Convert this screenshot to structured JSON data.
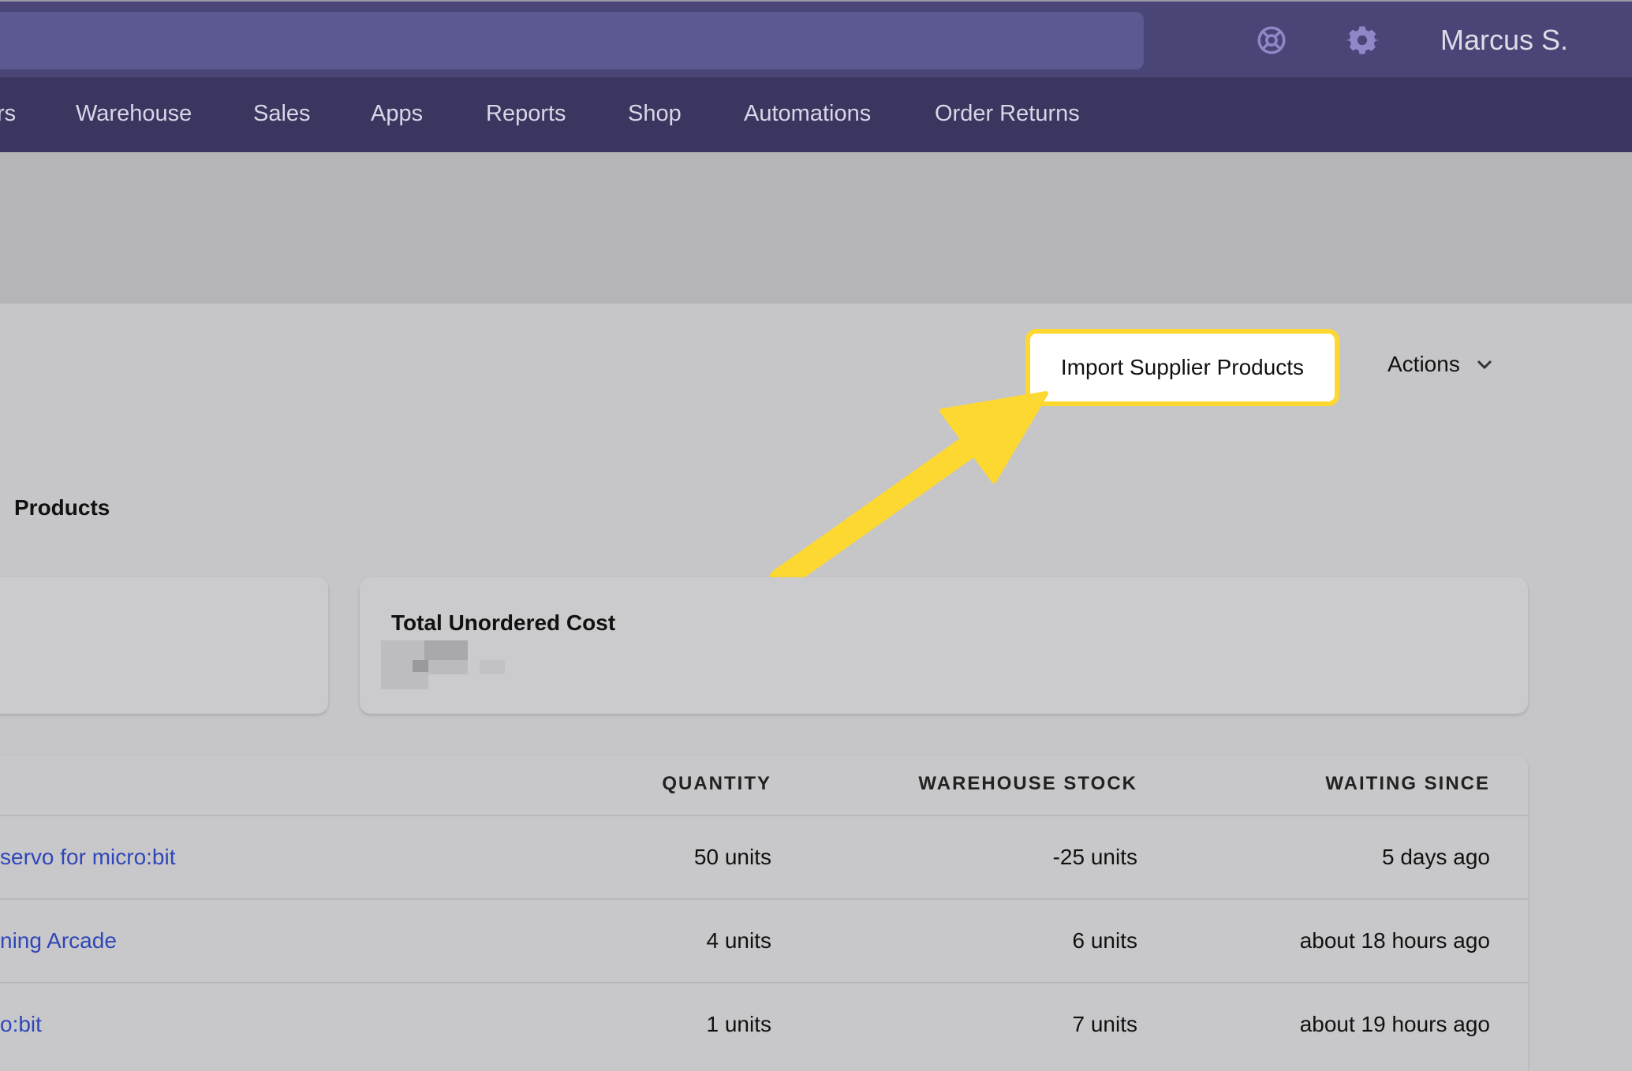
{
  "header": {
    "user_name": "Marcus S.",
    "icons": [
      "lifebuoy-icon",
      "gear-icon"
    ]
  },
  "nav": {
    "items": [
      "rs",
      "Warehouse",
      "Sales",
      "Apps",
      "Reports",
      "Shop",
      "Automations",
      "Order Returns"
    ]
  },
  "toolbar": {
    "import_label": "Import Supplier Products",
    "actions_label": "Actions"
  },
  "page": {
    "title": "Products"
  },
  "cards": [
    {
      "label": "Total Unordered Cost"
    }
  ],
  "table": {
    "headers": [
      "QUANTITY",
      "WAREHOUSE STOCK",
      "WAITING SINCE"
    ],
    "rows": [
      {
        "name": "servo for micro:bit",
        "quantity": "50 units",
        "stock": "-25 units",
        "waiting": "5 days ago"
      },
      {
        "name": "ning Arcade",
        "quantity": "4 units",
        "stock": "6 units",
        "waiting": "about 18 hours ago"
      },
      {
        "name": "o:bit",
        "quantity": "1 units",
        "stock": "7 units",
        "waiting": "about 19 hours ago"
      }
    ]
  },
  "colors": {
    "topbar": "#4a4577",
    "nav": "#3b3660",
    "highlight": "#fcd831",
    "link": "#2f47b8"
  }
}
